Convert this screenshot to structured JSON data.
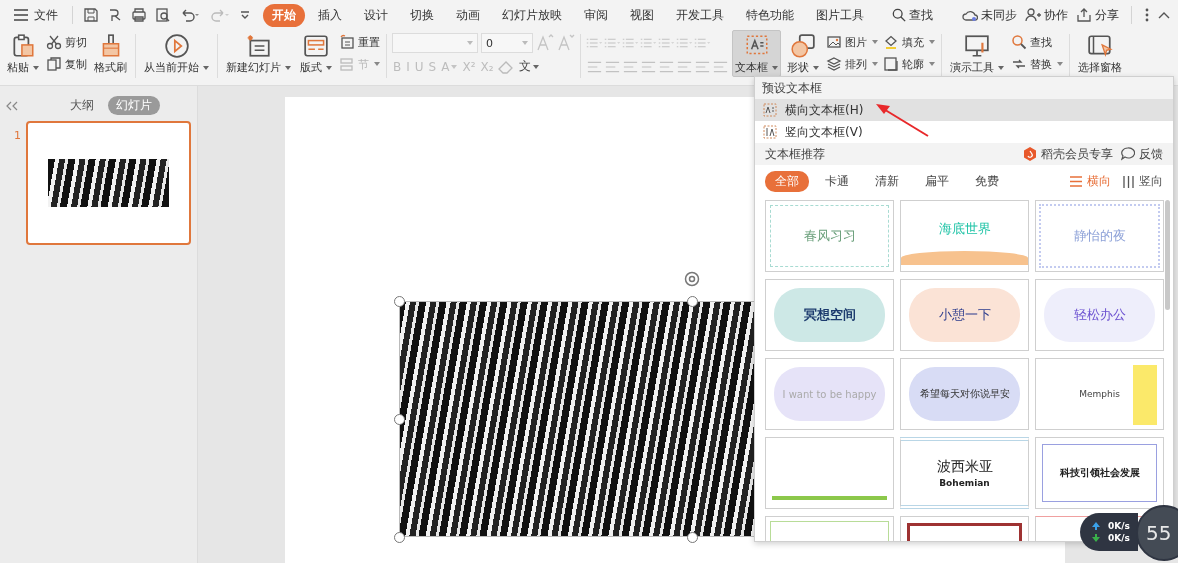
{
  "menu_bar": {
    "file_label": "文件",
    "tabs": [
      {
        "label": "开始",
        "selected": true
      },
      {
        "label": "插入",
        "selected": false
      },
      {
        "label": "设计",
        "selected": false
      },
      {
        "label": "切换",
        "selected": false
      },
      {
        "label": "动画",
        "selected": false
      },
      {
        "label": "幻灯片放映",
        "selected": false
      },
      {
        "label": "审阅",
        "selected": false
      },
      {
        "label": "视图",
        "selected": false
      },
      {
        "label": "开发工具",
        "selected": false
      },
      {
        "label": "特色功能",
        "selected": false
      },
      {
        "label": "图片工具",
        "selected": false
      }
    ],
    "search_label": "查找",
    "right_actions": [
      "未同步",
      "协作",
      "分享"
    ]
  },
  "ribbon": [
    {
      "kind": "large",
      "label": "粘贴",
      "dropdown": true,
      "pressed": false
    },
    {
      "kind": "stack",
      "items": [
        {
          "label": "剪切",
          "dropdown": false,
          "disabled": false
        },
        {
          "label": "复制",
          "dropdown": false,
          "disabled": false
        }
      ]
    },
    {
      "kind": "large",
      "label": "格式刷",
      "dropdown": false,
      "pressed": false
    },
    {
      "kind": "separator"
    },
    {
      "kind": "large",
      "label": "从当前开始",
      "dropdown": true,
      "pressed": false
    },
    {
      "kind": "separator"
    },
    {
      "kind": "large",
      "label": "新建幻灯片",
      "dropdown": true,
      "pressed": false
    },
    {
      "kind": "large",
      "label": "版式",
      "dropdown": true,
      "pressed": false
    },
    {
      "kind": "stack",
      "items": [
        {
          "label": "重置",
          "dropdown": false,
          "disabled": false
        },
        {
          "label": "节",
          "dropdown": true,
          "disabled": true
        }
      ]
    },
    {
      "kind": "separator"
    },
    {
      "kind": "font",
      "size_value": "0",
      "styles": [
        {
          "label": "B",
          "dropdown": false
        },
        {
          "label": "I",
          "dropdown": false
        },
        {
          "label": "U",
          "dropdown": false
        },
        {
          "label": "S",
          "dropdown": false
        },
        {
          "label": "A",
          "dropdown": true
        },
        {
          "label": "X²",
          "dropdown": false
        },
        {
          "label": "X₂",
          "dropdown": false
        }
      ],
      "script_label": "文"
    },
    {
      "kind": "separator"
    },
    {
      "kind": "paragraph"
    },
    {
      "kind": "large",
      "label": "文本框",
      "dropdown": true,
      "pressed": true
    },
    {
      "kind": "large",
      "label": "形状",
      "dropdown": true,
      "pressed": false
    },
    {
      "kind": "stack",
      "items": [
        {
          "label": "图片",
          "dropdown": true,
          "disabled": false
        },
        {
          "label": "排列",
          "dropdown": true,
          "disabled": false
        }
      ]
    },
    {
      "kind": "stack",
      "items": [
        {
          "label": "填充",
          "dropdown": true,
          "disabled": false
        },
        {
          "label": "轮廓",
          "dropdown": true,
          "disabled": false
        }
      ]
    },
    {
      "kind": "separator"
    },
    {
      "kind": "large",
      "label": "演示工具",
      "dropdown": true,
      "pressed": false
    },
    {
      "kind": "stack",
      "items": [
        {
          "label": "查找",
          "dropdown": false,
          "disabled": false
        },
        {
          "label": "替换",
          "dropdown": true,
          "disabled": false
        }
      ]
    },
    {
      "kind": "separator"
    },
    {
      "kind": "large",
      "label": "选择窗格",
      "dropdown": false,
      "pressed": false
    }
  ],
  "side_panel": {
    "tabs": [
      {
        "label": "大纲",
        "selected": false
      },
      {
        "label": "幻灯片",
        "selected": true
      }
    ],
    "slides": [
      {
        "number": "1",
        "selected": true
      }
    ]
  },
  "text_box_menu": {
    "preset_header": "预设文本框",
    "items": [
      {
        "label": "横向文本框(H)",
        "highlighted": true
      },
      {
        "label": "竖向文本框(V)",
        "highlighted": false
      }
    ],
    "recommend_header": "文本框推荐",
    "member_label": "稻壳会员专享",
    "feedback_label": "反馈",
    "filters": [
      {
        "label": "全部",
        "selected": true
      },
      {
        "label": "卡通",
        "selected": false
      },
      {
        "label": "清新",
        "selected": false
      },
      {
        "label": "扁平",
        "selected": false
      },
      {
        "label": "免费",
        "selected": false
      }
    ],
    "orientations": [
      {
        "label": "横向",
        "selected": true
      },
      {
        "label": "竖向",
        "selected": false
      }
    ],
    "templates": [
      {
        "kind": "spring",
        "title": "春风习习"
      },
      {
        "kind": "ocean",
        "title": "海底世界"
      },
      {
        "kind": "night",
        "title": "静怡的夜"
      },
      {
        "kind": "meditate",
        "title": "冥想空间"
      },
      {
        "kind": "rest",
        "title": "小憩一下"
      },
      {
        "kind": "office",
        "title": "轻松办公"
      },
      {
        "kind": "happy",
        "title": "I want to be happy"
      },
      {
        "kind": "morning",
        "title": "希望每天对你说早安"
      },
      {
        "kind": "memphis",
        "title": "Memphis"
      },
      {
        "kind": "reading"
      },
      {
        "kind": "bohemian",
        "title": "波西米亚",
        "subtitle": "Bohemian"
      },
      {
        "kind": "tech",
        "title": "科技引领社会发展"
      },
      {
        "kind": "fresh"
      },
      {
        "kind": "frame"
      },
      {
        "kind": "swoosh"
      }
    ]
  },
  "net_widget": {
    "upload": "0K/s",
    "download": "0K/s",
    "value": "55"
  }
}
